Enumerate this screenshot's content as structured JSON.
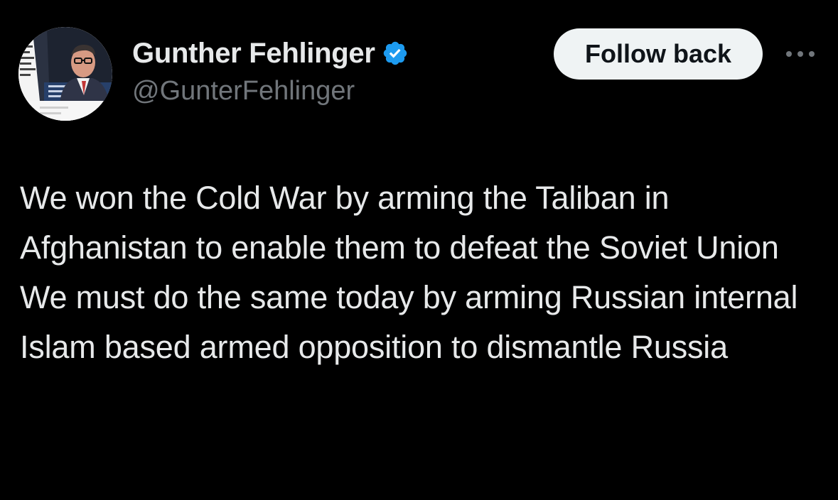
{
  "tweet": {
    "author": {
      "display_name": "Gunther Fehlinger",
      "handle": "@GunterFehlinger",
      "verified": true,
      "avatar_icon": "profile-photo"
    },
    "follow_label": "Follow back",
    "more_icon": "more-horizontal-icon",
    "text_paragraphs": [
      "We won the Cold War by arming the Taliban in Afghanistan to enable them to defeat the Soviet Union",
      "We must do the same today by arming Russian internal Islam based armed opposition to dismantle Russia"
    ]
  },
  "colors": {
    "background": "#000000",
    "primary_text": "#e7e9ea",
    "secondary_text": "#71767b",
    "verified_badge": "#1d9bf0",
    "follow_button_bg": "#eff3f4",
    "follow_button_text": "#0f1419"
  }
}
